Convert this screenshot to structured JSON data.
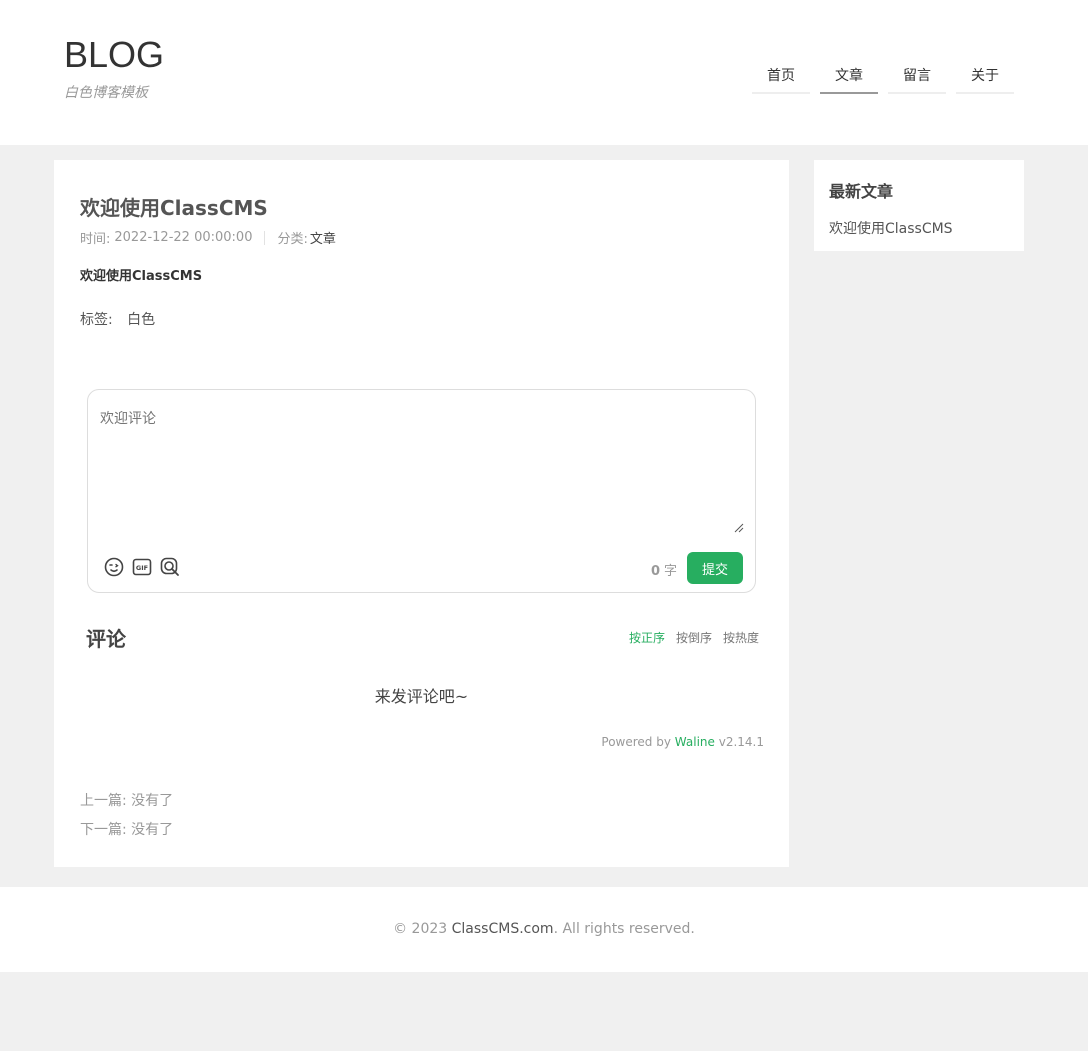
{
  "header": {
    "logo_title": "BLOG",
    "logo_subtitle": "白色博客模板",
    "nav": [
      {
        "label": "首页",
        "active": false
      },
      {
        "label": "文章",
        "active": true
      },
      {
        "label": "留言",
        "active": false
      },
      {
        "label": "关于",
        "active": false
      }
    ]
  },
  "article": {
    "title": "欢迎使用ClassCMS",
    "time_label": "时间:",
    "time_value": "2022-12-22 00:00:00",
    "category_label": "分类:",
    "category_value": "文章",
    "body": "欢迎使用ClassCMS",
    "tags_label": "标签:",
    "tags": [
      "白色"
    ]
  },
  "comment_form": {
    "placeholder": "欢迎评论",
    "word_count": "0",
    "word_unit": "字",
    "submit_label": "提交",
    "tools": [
      "emoji-icon",
      "gif-icon",
      "preview-icon"
    ]
  },
  "comments": {
    "heading": "评论",
    "sort_tabs": [
      {
        "label": "按正序",
        "active": true
      },
      {
        "label": "按倒序",
        "active": false
      },
      {
        "label": "按热度",
        "active": false
      }
    ],
    "empty_message": "来发评论吧~",
    "powered_prefix": "Powered by",
    "powered_brand": "Waline",
    "powered_version": "v2.14.1"
  },
  "pagination": {
    "prev": "上一篇: 没有了",
    "next": "下一篇: 没有了"
  },
  "sidebar": {
    "heading": "最新文章",
    "items": [
      "欢迎使用ClassCMS"
    ]
  },
  "footer": {
    "prefix": "© 2023",
    "brand": "ClassCMS.com",
    "suffix": ". All rights reserved."
  },
  "colors": {
    "accent": "#27ae60",
    "page_bg": "#f0f0f0"
  }
}
